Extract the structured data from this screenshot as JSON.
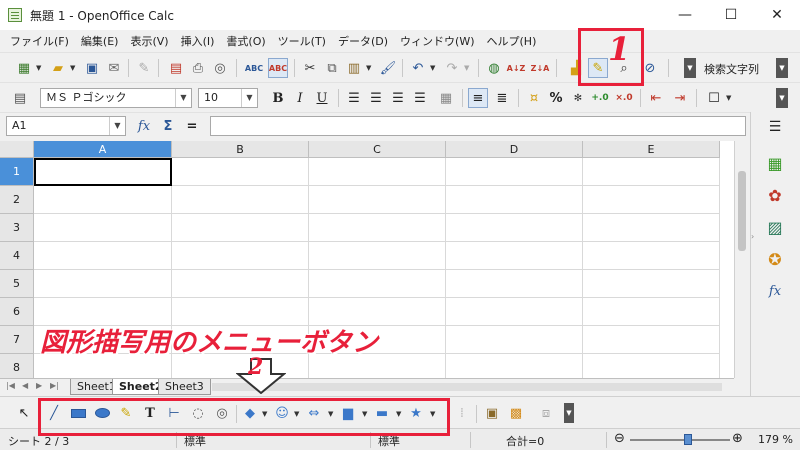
{
  "window": {
    "title": "無題 1 - OpenOffice Calc",
    "minimize": "—",
    "maximize": "☐",
    "close": "✕"
  },
  "menu": [
    "ファイル(F)",
    "編集(E)",
    "表示(V)",
    "挿入(I)",
    "書式(O)",
    "ツール(T)",
    "データ(D)",
    "ウィンドウ(W)",
    "ヘルプ(H)"
  ],
  "toolbar1": {
    "find_label": "検索文字列"
  },
  "toolbar2": {
    "font_name": "ＭＳ Ｐゴシック",
    "font_size": "10",
    "bold": "B",
    "italic": "I",
    "underline": "U",
    "percent": "%"
  },
  "formula_bar": {
    "name_box": "A1",
    "fx": "fx",
    "sigma": "Σ",
    "equals": "="
  },
  "grid": {
    "columns": [
      "A",
      "B",
      "C",
      "D",
      "E"
    ],
    "rows": [
      "1",
      "2",
      "3",
      "4",
      "5",
      "6",
      "7",
      "8"
    ],
    "selected_column": "A",
    "selected_row": "1"
  },
  "sheets": [
    "Sheet1",
    "Sheet2",
    "Sheet3"
  ],
  "active_sheet": "Sheet2",
  "drawing_toolbar": {
    "text_tool": "T"
  },
  "status": {
    "sheet": "シート 2 / 3",
    "style1": "標準",
    "style2": "標準",
    "sum": "合計=0",
    "zoom": "179 %"
  },
  "annotations": {
    "label1": "1",
    "label2": "2",
    "caption": "図形描写用のメニューボタン",
    "color": "#e8203a"
  }
}
